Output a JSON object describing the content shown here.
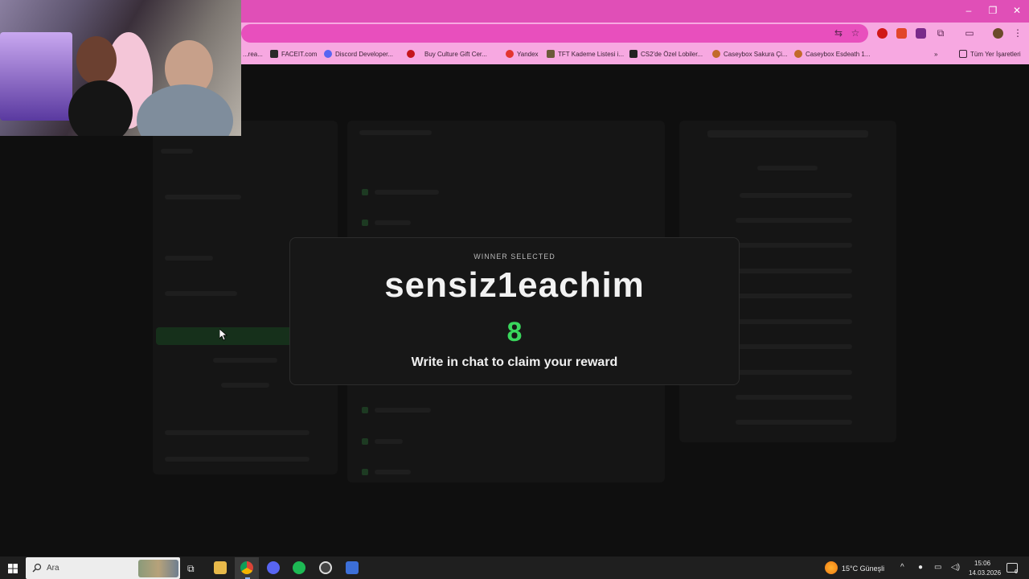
{
  "browser": {
    "bookmarks": [
      {
        "label": "...rea...",
        "color": "#8a6a8a"
      },
      {
        "label": "FACEIT.com",
        "color": "#2a2a2a"
      },
      {
        "label": "Discord Developer...",
        "color": "#5865f2"
      },
      {
        "label": "",
        "color": "#c4161c"
      },
      {
        "label": "Buy Culture Gift Cer...",
        "color": "#d94b8c"
      },
      {
        "label": "Yandex",
        "color": "#e3342f"
      },
      {
        "label": "TFT Kademe Listesi i...",
        "color": "#6b5a3a"
      },
      {
        "label": "CS2'de Özel Lobiler...",
        "color": "#222222"
      },
      {
        "label": "Caseybox Sakura Çi...",
        "color": "#c26a2a"
      },
      {
        "label": "Caseybox Esdeath 1...",
        "color": "#c26a2a"
      }
    ],
    "all_bookmarks_label": "Tüm Yer İşaretleri",
    "window_controls": [
      "–",
      "❐",
      "✕"
    ]
  },
  "modal": {
    "kicker": "WINNER SELECTED",
    "winner_name": "sensiz1eachim",
    "winner_number": "8",
    "claim_text": "Write in chat to claim your reward",
    "accent_color": "#39d65c"
  },
  "taskbar": {
    "search_placeholder": "Ara",
    "weather": "15°C  Güneşli",
    "time": "15:06",
    "date": "14.03.2026",
    "notification_count": "6"
  }
}
